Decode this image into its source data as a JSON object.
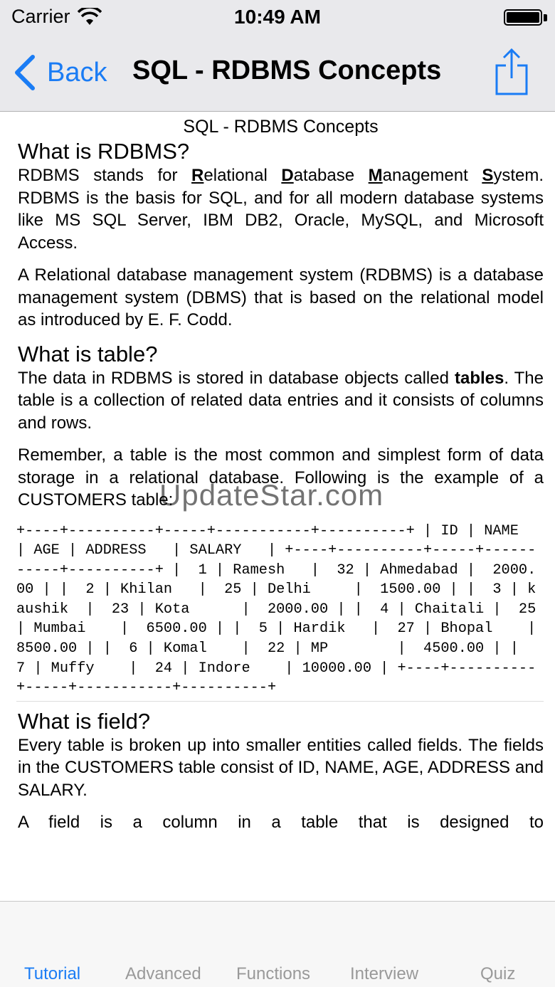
{
  "status_bar": {
    "carrier": "Carrier",
    "time": "10:49 AM"
  },
  "nav": {
    "back_label": "Back",
    "title": "SQL - RDBMS Concepts"
  },
  "content": {
    "doc_title": "SQL - RDBMS Concepts",
    "h_rdbms": "What is RDBMS?",
    "p_rdbms_1": {
      "lead": "RDBMS stands for ",
      "r": "R",
      "r_rest": "elational ",
      "d": "D",
      "d_rest": "atabase ",
      "m": "M",
      "m_rest": "anagement ",
      "s": "S",
      "s_rest": "ystem. RDBMS is the basis for SQL, and for all modern database systems like MS SQL Server, IBM DB2, Oracle, MySQL, and Microsoft Access."
    },
    "p_rdbms_2": "A Relational database management system (RDBMS) is a database management system (DBMS) that is based on the relational model as introduced by E. F. Codd.",
    "h_table": "What is table?",
    "p_table_1": {
      "before": "The data in RDBMS is stored in database objects called ",
      "bold": "tables",
      "after": ". The table is a collection of related data entries and it consists of columns and rows."
    },
    "p_table_2": "Remember, a table is the most common and simplest form of data storage in a relational database. Following is the example of a CUSTOMERS table:",
    "customers_table": "+----+----------+-----+-----------+----------+ | ID | NAME     | AGE | ADDRESS   | SALARY   | +----+----------+-----+-----------+----------+ |  1 | Ramesh   |  32 | Ahmedabad |  2000.00 | |  2 | Khilan   |  25 | Delhi     |  1500.00 | |  3 | kaushik  |  23 | Kota      |  2000.00 | |  4 | Chaitali |  25 | Mumbai    |  6500.00 | |  5 | Hardik   |  27 | Bhopal    |  8500.00 | |  6 | Komal    |  22 | MP        |  4500.00 | |  7 | Muffy    |  24 | Indore    | 10000.00 | +----+----------+-----+-----------+----------+",
    "h_field": "What is field?",
    "p_field_1": "Every table is broken up into smaller entities called fields. The fields in the CUSTOMERS table consist of ID, NAME, AGE, ADDRESS and SALARY.",
    "p_field_2": "A field is a column in a table that is designed to"
  },
  "watermark": "UpdateStar.com",
  "tabs": [
    {
      "label": "Tutorial",
      "active": true
    },
    {
      "label": "Advanced",
      "active": false
    },
    {
      "label": "Functions",
      "active": false
    },
    {
      "label": "Interview",
      "active": false
    },
    {
      "label": "Quiz",
      "active": false
    }
  ],
  "colors": {
    "accent": "#1a7cf5",
    "bar_bg": "#e9e9ec",
    "tab_inactive": "#999999"
  }
}
